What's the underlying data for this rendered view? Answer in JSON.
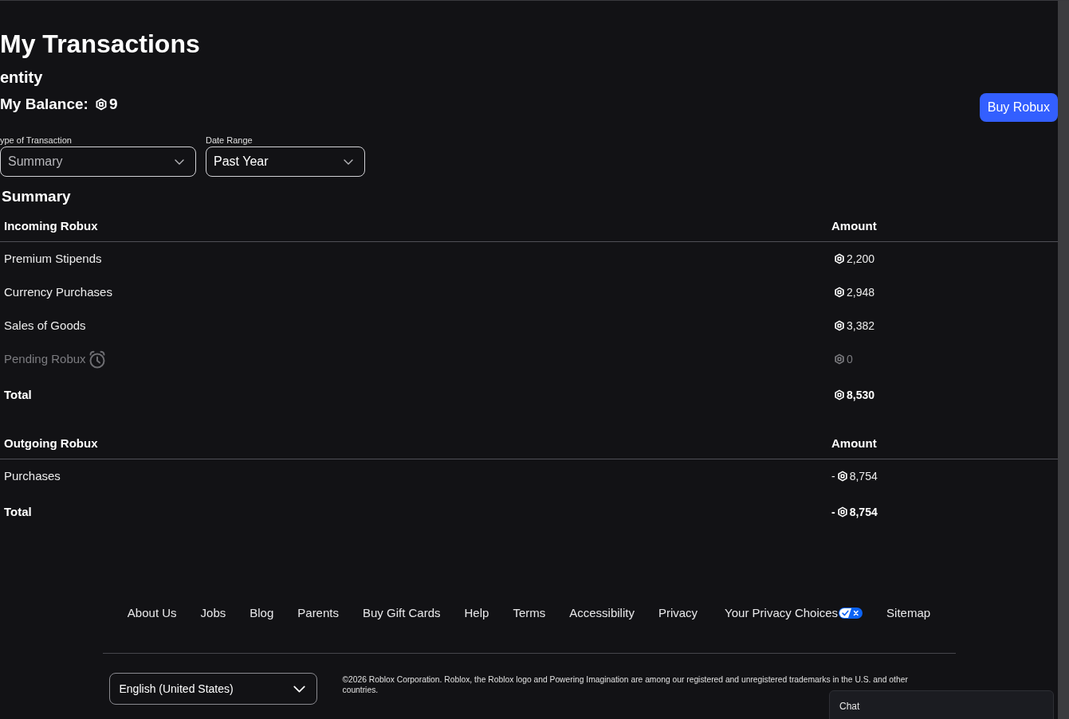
{
  "page_title": "My Transactions",
  "section_heading": "entity",
  "balance": {
    "label": "My Balance:",
    "amount": "9"
  },
  "buy_button": "Buy Robux",
  "filters": [
    {
      "label": "ype of Transaction",
      "value": "Summary",
      "disabled": true
    },
    {
      "label": "Date Range",
      "value": "Past Year",
      "disabled": false
    }
  ],
  "summary": {
    "title": "Summary",
    "tables": [
      {
        "columns": [
          "Incoming Robux",
          "Amount"
        ],
        "rows": [
          {
            "kind": "item",
            "label": "Premium Stipends",
            "amount": "2,200"
          },
          {
            "kind": "item",
            "label": "Currency Purchases",
            "amount": "2,948"
          },
          {
            "kind": "item",
            "label": "Sales of Goods",
            "amount": "3,382"
          },
          {
            "kind": "pending",
            "label": "Pending Robux",
            "amount": "0"
          },
          {
            "kind": "total",
            "label": "Total",
            "amount": "8,530"
          }
        ]
      },
      {
        "columns": [
          "Outgoing Robux",
          "Amount"
        ],
        "rows": [
          {
            "kind": "item",
            "label": "Purchases",
            "sign": "-",
            "amount": "8,754"
          },
          {
            "kind": "total",
            "label": "Total",
            "sign": "-",
            "amount": "8,754"
          }
        ]
      }
    ]
  },
  "footer": {
    "links": [
      {
        "kind": "plain",
        "label": "About Us"
      },
      {
        "kind": "plain",
        "label": "Jobs"
      },
      {
        "kind": "plain",
        "label": "Blog"
      },
      {
        "kind": "plain",
        "label": "Parents"
      },
      {
        "kind": "plain",
        "label": "Buy Gift Cards"
      },
      {
        "kind": "plain",
        "label": "Help"
      },
      {
        "kind": "plain",
        "label": "Terms"
      },
      {
        "kind": "plain",
        "label": "Accessibility"
      },
      {
        "kind": "plain",
        "label": "Privacy"
      },
      {
        "kind": "privacy_choices",
        "label": "Your Privacy Choices"
      },
      {
        "kind": "plain",
        "label": "Sitemap"
      }
    ],
    "language": "English (United States)",
    "copyright": "©2026 Roblox Corporation. Roblox, the Roblox logo and Powering Imagination are among our registered and unregistered trademarks in the U.S. and other countries."
  },
  "chat": {
    "label": "Chat"
  }
}
